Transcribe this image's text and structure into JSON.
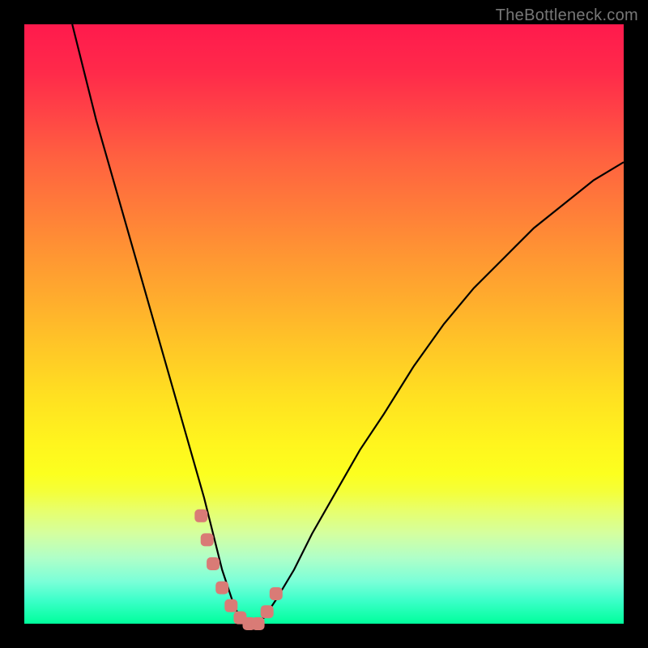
{
  "watermark": {
    "text": "TheBottleneck.com"
  },
  "chart_data": {
    "type": "line",
    "title": "",
    "xlabel": "",
    "ylabel": "",
    "xlim": [
      0,
      100
    ],
    "ylim": [
      0,
      100
    ],
    "series": [
      {
        "name": "bottleneck-curve",
        "x": [
          8,
          10,
          12,
          14,
          16,
          18,
          20,
          22,
          24,
          26,
          28,
          30,
          31,
          32,
          33,
          34,
          35,
          36,
          37,
          38,
          40,
          42,
          45,
          48,
          52,
          56,
          60,
          65,
          70,
          75,
          80,
          85,
          90,
          95,
          100
        ],
        "values": [
          100,
          92,
          84,
          77,
          70,
          63,
          56,
          49,
          42,
          35,
          28,
          21,
          17,
          13,
          9,
          6,
          3,
          1,
          0,
          0,
          1,
          4,
          9,
          15,
          22,
          29,
          35,
          43,
          50,
          56,
          61,
          66,
          70,
          74,
          77
        ]
      }
    ],
    "markers": {
      "name": "highlight-points",
      "x": [
        29.5,
        30.5,
        31.5,
        33.0,
        34.5,
        36.0,
        37.5,
        39.0,
        40.5,
        42.0
      ],
      "values": [
        18,
        14,
        10,
        6,
        3,
        1,
        0,
        0,
        2,
        5
      ]
    }
  }
}
